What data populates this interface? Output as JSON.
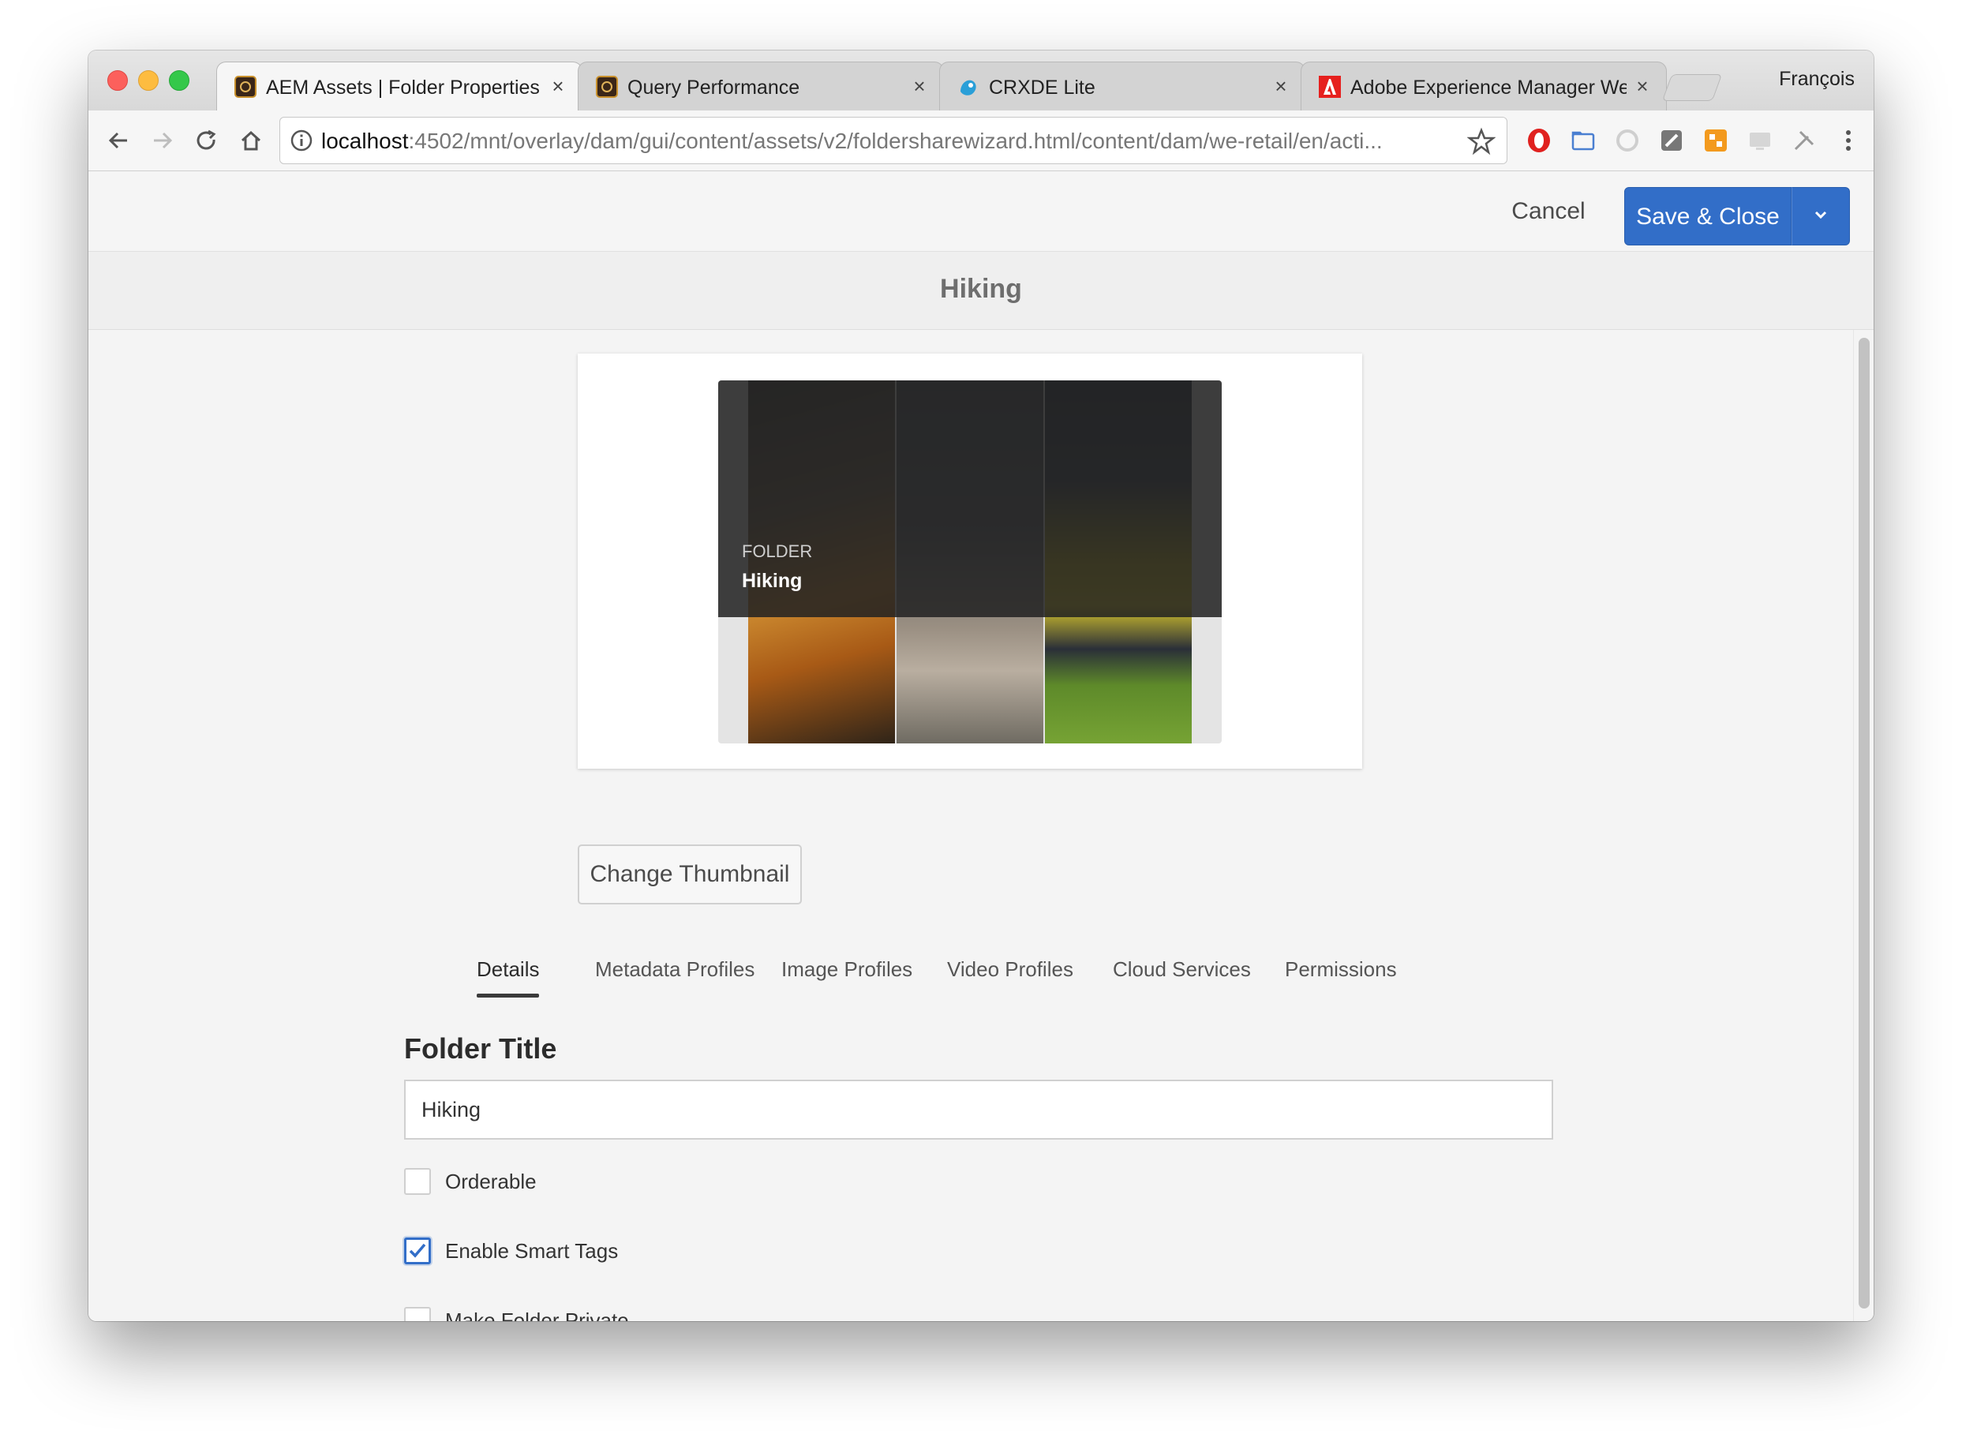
{
  "browser": {
    "tabs": [
      {
        "title": "AEM Assets | Folder Properties",
        "icon": "aem-icon"
      },
      {
        "title": "Query Performance",
        "icon": "aem-icon"
      },
      {
        "title": "CRXDE Lite",
        "icon": "crxde-icon"
      },
      {
        "title": "Adobe Experience Manager Web Console",
        "icon": "adobe-icon"
      }
    ],
    "tab_close_glyph": "×",
    "profile_name": "François",
    "url_host": "localhost",
    "url_path": ":4502/mnt/overlay/dam/gui/content/assets/v2/foldersharewizard.html/content/dam/we-retail/en/acti..."
  },
  "header": {
    "cancel_label": "Cancel",
    "save_label": "Save & Close",
    "accent_color": "#326ec8"
  },
  "page": {
    "title": "Hiking"
  },
  "thumbnail": {
    "kind_label": "FOLDER",
    "name": "Hiking",
    "change_button_label": "Change Thumbnail"
  },
  "tabs": [
    {
      "label": "Details",
      "active": true
    },
    {
      "label": "Metadata Profiles",
      "active": false
    },
    {
      "label": "Image Profiles",
      "active": false
    },
    {
      "label": "Video Profiles",
      "active": false
    },
    {
      "label": "Cloud Services",
      "active": false
    },
    {
      "label": "Permissions",
      "active": false
    }
  ],
  "form": {
    "folder_title_label": "Folder Title",
    "folder_title_value": "Hiking",
    "checkboxes": [
      {
        "label": "Orderable",
        "checked": false
      },
      {
        "label": "Enable Smart Tags",
        "checked": true
      },
      {
        "label": "Make Folder Private",
        "checked": false
      }
    ]
  }
}
